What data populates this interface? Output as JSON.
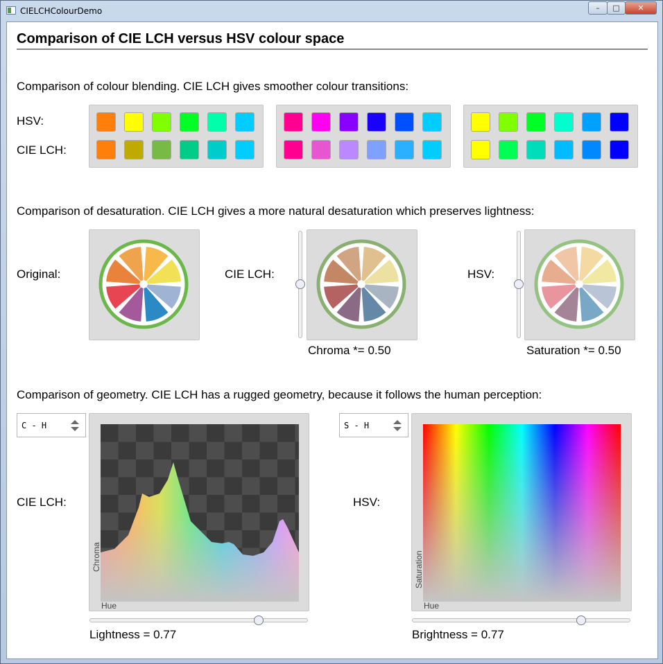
{
  "window": {
    "title": "CIELCHColourDemo",
    "minimize": "–",
    "maximize": "□",
    "close": "✕"
  },
  "heading": "Comparison of CIE LCH versus HSV colour space",
  "blending": {
    "caption": "Comparison of colour blending. CIE LCH gives smoother colour transitions:",
    "hsv_label": "HSV:",
    "lch_label": "CIE LCH:",
    "groups": [
      {
        "hsv": [
          "#ff7f0a",
          "#ffff00",
          "#7fff00",
          "#00ff24",
          "#00ffaa",
          "#00ccff"
        ],
        "lch": [
          "#ff7f0a",
          "#bfaa00",
          "#77bb44",
          "#00cc88",
          "#00cccc",
          "#00ccff"
        ]
      },
      {
        "hsv": [
          "#ff0090",
          "#ff00f0",
          "#8800ff",
          "#1a00ff",
          "#0050ff",
          "#00ccff"
        ],
        "lch": [
          "#ff0090",
          "#e855d0",
          "#bb88ff",
          "#7fa0ff",
          "#2ab0ff",
          "#00ccff"
        ]
      },
      {
        "hsv": [
          "#ffff00",
          "#7fff00",
          "#00ff24",
          "#00ffcc",
          "#00a0ff",
          "#0000ff"
        ],
        "lch": [
          "#ffff00",
          "#00ff55",
          "#00ddbb",
          "#00bbff",
          "#0088ff",
          "#0000ff"
        ]
      }
    ]
  },
  "desaturation": {
    "caption": "Comparison of desaturation. CIE LCH gives a more natural desaturation which preserves lightness:",
    "original_label": "Original:",
    "lch_label": "CIE LCH:",
    "hsv_label": "HSV:",
    "chroma_text": "Chroma *= 0.50",
    "saturation_text": "Saturation *= 0.50",
    "chroma_factor": 0.5,
    "saturation_factor": 0.5,
    "rind_colors": {
      "original": "#6bb84a",
      "lch": "#89b070",
      "hsv": "#94c280"
    },
    "segments": {
      "original": [
        "#f7b94a",
        "#f2e155",
        "#9fb4d5",
        "#2b89c6",
        "#a3599a",
        "#e84552",
        "#e9823a",
        "#f0a34d"
      ],
      "lch": [
        "#dfc08e",
        "#ede1a1",
        "#a9b4c3",
        "#6688a8",
        "#8b6a86",
        "#b56263",
        "#c48766",
        "#d1a584"
      ],
      "hsv": [
        "#f4d9a3",
        "#f1e8a2",
        "#b9c4d6",
        "#78a8c6",
        "#a48496",
        "#e8959e",
        "#e8ad8e",
        "#f0c6a6"
      ]
    }
  },
  "geometry": {
    "caption": "Comparison of geometry. CIE LCH has a rugged geometry, because it follows the human perception:",
    "lch": {
      "select_value": "C - H",
      "row_label": "CIE LCH:",
      "axis_y": "Chroma",
      "axis_x": "Hue",
      "slider_text": "Lightness = 0.77",
      "lightness": 0.77
    },
    "hsv": {
      "select_value": "S - H",
      "row_label": "HSV:",
      "axis_y": "Saturation",
      "axis_x": "Hue",
      "slider_text": "Brightness = 0.77",
      "brightness": 0.77
    }
  }
}
